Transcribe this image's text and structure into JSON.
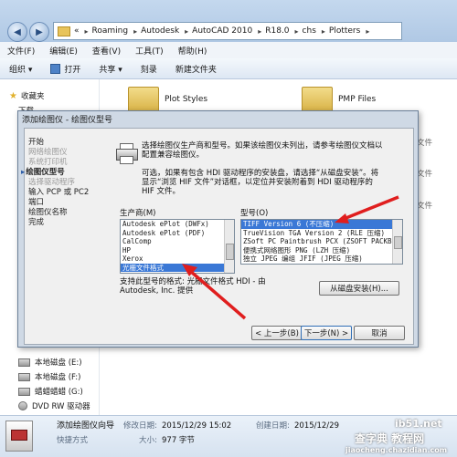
{
  "explorer": {
    "address": {
      "prefix": "«",
      "crumbs": [
        "Roaming",
        "Autodesk",
        "AutoCAD 2010",
        "R18.0",
        "chs",
        "Plotters"
      ]
    },
    "menu": [
      "文件(F)",
      "编辑(E)",
      "查看(V)",
      "工具(T)",
      "帮助(H)"
    ],
    "toolbar": {
      "organize": "组织 ▾",
      "open": "打开",
      "share": "共享 ▾",
      "burn": "刻录",
      "new_folder": "新建文件夹"
    },
    "sidebar": {
      "favorites": "收藏夹",
      "download": "下载",
      "drives": [
        "本地磁盘 (E:)",
        "本地磁盘 (F:)",
        "蜡蜡蜡蜡 (G:)",
        "DVD RW 驱动器"
      ]
    },
    "folders": [
      "Plot Styles",
      "PMP Files"
    ],
    "right_col": [
      "文件",
      "文件",
      "文件"
    ],
    "status": {
      "name": "添加绘图仪向导",
      "modified_label": "修改日期:",
      "modified": "2015/12/29 15:02",
      "created_label": "创建日期:",
      "created": "2015/12/29",
      "kind": "快捷方式",
      "size_label": "大小:",
      "size": "977 字节"
    },
    "watermark": {
      "site": "ib51.net",
      "brand": "查字典 教程网",
      "url": "jiaocheng.chazidian.com"
    }
  },
  "dialog": {
    "title": "添加绘图仪 - 绘图仪型号",
    "steps": [
      {
        "label": "开始",
        "state": "normal"
      },
      {
        "label": "网络绘图仪",
        "state": "dim"
      },
      {
        "label": "系统打印机",
        "state": "dim"
      },
      {
        "label": "绘图仪型号",
        "state": "active"
      },
      {
        "label": "选择驱动程序",
        "state": "dim"
      },
      {
        "label": "输入 PCP 或 PC2",
        "state": "normal"
      },
      {
        "label": "端口",
        "state": "normal"
      },
      {
        "label": "绘图仪名称",
        "state": "normal"
      },
      {
        "label": "完成",
        "state": "normal"
      }
    ],
    "intro_line1": "选择绘图仪生产商和型号。如果该绘图仪未列出，请参考绘图仪文档以",
    "intro_line2": "配置兼容绘图仪。",
    "hdi_line1": "可选，如果有包含 HDI 驱动程序的安装盘，请选择“从磁盘安装”。将",
    "hdi_line2": "显示“浏览 HIF 文件”对话框，以定位并安装附着到 HDI 驱动程序的",
    "hdi_line3": "HIF 文件。",
    "manufacturer_label": "生产商(M)",
    "manufacturers": [
      {
        "label": "Autodesk ePlot (DWFx)",
        "selected": false
      },
      {
        "label": "Autodesk ePlot (PDF)",
        "selected": false
      },
      {
        "label": "CalComp",
        "selected": false
      },
      {
        "label": "HP",
        "selected": false
      },
      {
        "label": "Xerox",
        "selected": false
      },
      {
        "label": "光栅文件格式",
        "selected": true
      }
    ],
    "model_label": "型号(O)",
    "models": [
      {
        "label": "TIFF Version 6 (不压缩)",
        "selected": true
      },
      {
        "label": "TrueVision TGA Version 2 (RLE 压缩)",
        "selected": false
      },
      {
        "label": "ZSoft PC Paintbrush PCX (ZSOFT PACKB",
        "selected": false
      },
      {
        "label": "便携式网络图形 PNG (LZH 压缩)",
        "selected": false
      },
      {
        "label": "独立 JPEG 编组 JFIF (JPEG 压缩)",
        "selected": false
      }
    ],
    "support_line1": "支持此型号的格式: 光栅文件格式 HDI - 由",
    "support_line2": "Autodesk, Inc. 提供",
    "from_disk": "从磁盘安装(H)...",
    "back": "< 上一步(B)",
    "next": "下一步(N) >",
    "cancel": "取消"
  }
}
